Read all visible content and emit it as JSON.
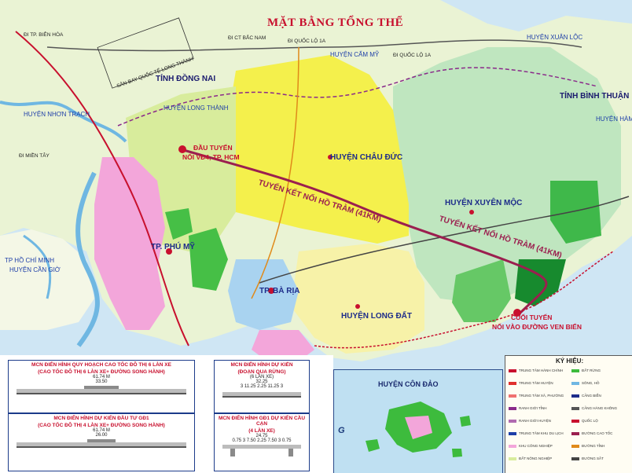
{
  "title": "MẶT BẰNG TỔNG THỂ",
  "labels": {
    "tinh_dong_nai": "TỈNH ĐỒNG NAI",
    "tinh_binh_thuan": "TỈNH BÌNH THUẬN",
    "tp_hcm": "TP HỒ CHÍ MINH",
    "huyen_can_gio": "HUYỆN CẦN GIỜ",
    "huyen_nhon_trach": "HUYỆN NHƠN TRẠCH",
    "huyen_long_thanh": "HUYỆN LONG THÀNH",
    "huyen_cam_my": "HUYỆN CẨM MỸ",
    "huyen_xuan_loc": "HUYỆN XUÂN LỘC",
    "huyen_ham_tan": "HUYỆN HÀM TÂN",
    "huyen_chau_duc": "HUYỆN CHÂU ĐỨC",
    "huyen_xuyen_moc": "HUYỆN XUYÊN MỘC",
    "huyen_long_dat": "HUYỆN LONG ĐẤT",
    "tp_phu_my": "TP. PHÚ MỸ",
    "tp_ba_ria": "TP. BÀ RỊA",
    "san_bay": "SÂN BAY QUỐC TẾ LONG THÀNH",
    "di_tp_bien_hoa": "ĐI TP. BIÊN HÒA",
    "di_ct_bac_nam": "ĐI CT BẮC NAM",
    "di_ql1a_1": "ĐI QUỐC LỘ 1A",
    "di_ql1a_2": "ĐI QUỐC LỘ 1A",
    "di_mien_tay": "ĐI MIỀN TÂY",
    "dau_tuyen_1": "ĐẦU TUYẾN",
    "dau_tuyen_2": "NỐI VĐ4, TP. HCM",
    "cuoi_tuyen_1": "CUỐI TUYẾN",
    "cuoi_tuyen_2": "NỐI VÀO ĐƯỜNG VEN BIỂN",
    "tuyen_ket_noi_1": "TUYẾN KẾT NỐI HỒ TRÀM (41KM)",
    "tuyen_ket_noi_2": "TUYẾN KẾT NỐI HỒ TRÀM (41KM)",
    "huyen_con_dao": "HUYỆN CÔN ĐẢO",
    "g": "G"
  },
  "sections": {
    "s1_title_1": "MCN ĐIỂN HÌNH QUY HOẠCH CAO TỐC ĐÔ THỊ 6 LÀN XE",
    "s1_title_2": "(CAO TỐC ĐÔ THỊ 6 LÀN XE+ ĐƯỜNG SONG HÀNH)",
    "s1_width": "61.74 M",
    "s1_inner": "33.50",
    "s2_title_1": "MCN ĐIỂN HÌNH DỰ KIẾN ĐẦU TƯ GĐ1",
    "s2_title_2": "(CAO TỐC ĐÔ THỊ 4 LÀN XE+ ĐƯỜNG SONG HÀNH)",
    "s2_width": "61.74 M",
    "s2_inner": "26.00",
    "s3_title_1": "MCN ĐIỂN HÌNH DỰ KIẾN",
    "s3_title_2": "(ĐOẠN QUA RỪNG)",
    "s3_width": "32.25",
    "s3_sub": "(6 LÀN XE)",
    "s3_dims": "3  11.25  2.25  11.25  3",
    "s4_title_1": "MCN ĐIỂN HÌNH GĐ1 DỰ KIẾN CẦU CẠN",
    "s4_title_2": "(4 LÀN XE)",
    "s4_width": "24.75",
    "s4_dims": "0.75  3  7.50  2.25  7.50  3  0.75"
  },
  "legend": {
    "title": "KÝ HIỆU:",
    "items": [
      "TRUNG TÂM HÀNH CHÍNH",
      "TRUNG TÂM HUYỆN",
      "TRUNG TÂM XÃ, PHƯỜNG",
      "RANH GIỚI TỈNH",
      "RANH GIỚI HUYỆN",
      "TRUNG TÂM KHU DU LỊCH",
      "KHU CÔNG NGHIỆP",
      "ĐẤT NÔNG NGHIỆP",
      "ĐẤT RỪNG",
      "SÔNG, HỒ",
      "CẢNG BIỂN",
      "CẢNG HÀNG KHÔNG",
      "QUỐC LỘ",
      "ĐƯỜNG CAO TỐC",
      "ĐƯỜNG TỈNH",
      "ĐƯỜNG SẮT"
    ]
  },
  "colors": {
    "sea": "#bfe0f2",
    "land_light": "#e6f2cf",
    "chau_duc_yellow": "#f3f050",
    "xuyen_moc_green": "#b8e3b8",
    "forest": "#3dbb3d",
    "forest_dark": "#168a2e",
    "urban_pink": "#f2a2d8",
    "ba_ria_blue": "#a9d3f0",
    "route": "#9b1f4f"
  }
}
